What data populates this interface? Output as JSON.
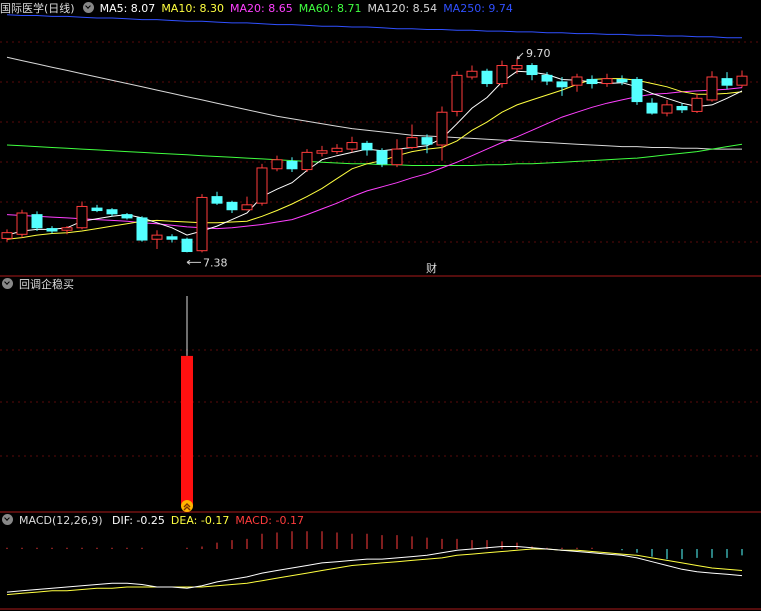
{
  "colors": {
    "background": "#000000",
    "separator": "#aa1a1a",
    "grid": "#5a0a0a",
    "up": "#ff3c3c",
    "down": "#54ffff",
    "ma5": "#ffffff",
    "ma10": "#ffff40",
    "ma20": "#ff40ff",
    "ma60": "#40ff40",
    "ma120": "#d8d8d8",
    "ma250": "#3050ff",
    "signal_bar": "#ff1010",
    "signal_icon": "#ffb400",
    "dif": "#ffffff",
    "dea": "#ffff40",
    "macd_up": "#ff3c3c",
    "macd_down": "#54ffff"
  },
  "price_panel": {
    "title": "国际医学(日线)",
    "legend": [
      {
        "key": "ma5",
        "text": "MA5: 8.07"
      },
      {
        "key": "ma10",
        "text": "MA10: 8.30"
      },
      {
        "key": "ma20",
        "text": "MA20: 8.65"
      },
      {
        "key": "ma60",
        "text": "MA60: 8.71"
      },
      {
        "key": "ma120",
        "text": "MA120: 8.54"
      },
      {
        "key": "ma250",
        "text": "MA250: 9.74"
      }
    ],
    "high_label": "9.70",
    "low_label": "7.38",
    "event_marker": "财"
  },
  "indicator_panel": {
    "title": "回调企稳买"
  },
  "macd_panel": {
    "title": "MACD(12,26,9)",
    "legend": [
      {
        "key": "dif",
        "text": "DIF: -0.25"
      },
      {
        "key": "dea",
        "text": "DEA: -0.17"
      },
      {
        "key": "macd_up",
        "text": "MACD: -0.17"
      }
    ]
  },
  "chart_data": {
    "type": "candlestick",
    "price_range": [
      7.1,
      10.2
    ],
    "candles": [
      [
        7.51,
        7.58,
        7.62,
        7.47
      ],
      [
        7.56,
        7.82,
        7.86,
        7.52
      ],
      [
        7.8,
        7.64,
        7.84,
        7.6
      ],
      [
        7.63,
        7.6,
        7.66,
        7.57
      ],
      [
        7.61,
        7.64,
        7.66,
        7.56
      ],
      [
        7.64,
        7.9,
        7.96,
        7.62
      ],
      [
        7.88,
        7.85,
        7.92,
        7.83
      ],
      [
        7.86,
        7.81,
        7.88,
        7.78
      ],
      [
        7.8,
        7.76,
        7.82,
        7.74
      ],
      [
        7.76,
        7.49,
        7.78,
        7.47
      ],
      [
        7.5,
        7.55,
        7.61,
        7.38
      ],
      [
        7.53,
        7.5,
        7.56,
        7.46
      ],
      [
        7.5,
        7.35,
        7.52,
        7.34
      ],
      [
        7.36,
        8.01,
        8.05,
        7.34
      ],
      [
        8.02,
        7.94,
        8.08,
        7.92
      ],
      [
        7.95,
        7.86,
        7.97,
        7.82
      ],
      [
        7.86,
        7.92,
        8.02,
        7.85
      ],
      [
        7.94,
        8.37,
        8.42,
        7.91
      ],
      [
        8.36,
        8.47,
        8.52,
        8.33
      ],
      [
        8.45,
        8.36,
        8.5,
        8.32
      ],
      [
        8.35,
        8.56,
        8.6,
        8.32
      ],
      [
        8.55,
        8.58,
        8.64,
        8.51
      ],
      [
        8.57,
        8.61,
        8.66,
        8.54
      ],
      [
        8.6,
        8.68,
        8.75,
        8.56
      ],
      [
        8.67,
        8.59,
        8.7,
        8.52
      ],
      [
        8.58,
        8.42,
        8.61,
        8.38
      ],
      [
        8.41,
        8.6,
        8.72,
        8.38
      ],
      [
        8.62,
        8.74,
        8.9,
        8.6
      ],
      [
        8.74,
        8.66,
        8.78,
        8.55
      ],
      [
        8.65,
        9.05,
        9.12,
        8.46
      ],
      [
        9.06,
        9.5,
        9.55,
        9.0
      ],
      [
        9.48,
        9.55,
        9.62,
        9.45
      ],
      [
        9.55,
        9.4,
        9.58,
        9.36
      ],
      [
        9.4,
        9.62,
        9.68,
        9.35
      ],
      [
        9.58,
        9.62,
        9.7,
        9.52
      ],
      [
        9.62,
        9.51,
        9.65,
        9.44
      ],
      [
        9.5,
        9.43,
        9.54,
        9.38
      ],
      [
        9.42,
        9.36,
        9.48,
        9.25
      ],
      [
        9.38,
        9.48,
        9.52,
        9.3
      ],
      [
        9.45,
        9.4,
        9.5,
        9.34
      ],
      [
        9.4,
        9.46,
        9.52,
        9.36
      ],
      [
        9.45,
        9.42,
        9.5,
        9.38
      ],
      [
        9.45,
        9.18,
        9.48,
        9.14
      ],
      [
        9.16,
        9.04,
        9.22,
        9.02
      ],
      [
        9.04,
        9.14,
        9.2,
        9.0
      ],
      [
        9.12,
        9.08,
        9.16,
        9.04
      ],
      [
        9.06,
        9.22,
        9.28,
        9.04
      ],
      [
        9.2,
        9.48,
        9.55,
        9.18
      ],
      [
        9.46,
        9.38,
        9.54,
        9.33
      ],
      [
        9.38,
        9.49,
        9.56,
        9.35
      ]
    ],
    "ma5": [
      7.55,
      7.6,
      7.62,
      7.62,
      7.64,
      7.72,
      7.75,
      7.78,
      7.8,
      7.76,
      7.7,
      7.64,
      7.55,
      7.6,
      7.66,
      7.74,
      7.82,
      8.02,
      8.11,
      8.19,
      8.34,
      8.47,
      8.52,
      8.56,
      8.6,
      8.58,
      8.6,
      8.62,
      8.64,
      8.73,
      8.91,
      9.1,
      9.23,
      9.42,
      9.55,
      9.54,
      9.51,
      9.45,
      9.44,
      9.42,
      9.4,
      9.41,
      9.36,
      9.28,
      9.22,
      9.16,
      9.12,
      9.14,
      9.22,
      9.31
    ],
    "ma10": [
      7.5,
      7.52,
      7.55,
      7.57,
      7.58,
      7.6,
      7.63,
      7.66,
      7.69,
      7.72,
      7.73,
      7.72,
      7.71,
      7.7,
      7.7,
      7.71,
      7.72,
      7.78,
      7.85,
      7.93,
      8.02,
      8.12,
      8.24,
      8.36,
      8.42,
      8.46,
      8.52,
      8.57,
      8.6,
      8.62,
      8.7,
      8.83,
      8.93,
      9.05,
      9.14,
      9.2,
      9.26,
      9.32,
      9.39,
      9.45,
      9.46,
      9.46,
      9.44,
      9.4,
      9.36,
      9.3,
      9.27,
      9.27,
      9.28,
      9.3
    ],
    "ma20": [
      7.8,
      7.79,
      7.78,
      7.77,
      7.76,
      7.75,
      7.74,
      7.73,
      7.72,
      7.7,
      7.69,
      7.67,
      7.65,
      7.64,
      7.63,
      7.64,
      7.66,
      7.68,
      7.71,
      7.74,
      7.8,
      7.87,
      7.94,
      8.02,
      8.09,
      8.14,
      8.19,
      8.25,
      8.3,
      8.37,
      8.44,
      8.52,
      8.6,
      8.68,
      8.75,
      8.83,
      8.91,
      8.99,
      9.05,
      9.11,
      9.16,
      9.2,
      9.24,
      9.27,
      9.28,
      9.3,
      9.31,
      9.32,
      9.33,
      9.35
    ],
    "ma60": [
      8.65,
      8.64,
      8.63,
      8.62,
      8.61,
      8.6,
      8.59,
      8.58,
      8.57,
      8.56,
      8.55,
      8.54,
      8.53,
      8.52,
      8.51,
      8.5,
      8.49,
      8.48,
      8.47,
      8.46,
      8.45,
      8.44,
      8.43,
      8.42,
      8.42,
      8.41,
      8.41,
      8.4,
      8.4,
      8.4,
      8.4,
      8.4,
      8.41,
      8.41,
      8.42,
      8.42,
      8.43,
      8.44,
      8.45,
      8.46,
      8.47,
      8.48,
      8.49,
      8.51,
      8.53,
      8.55,
      8.57,
      8.6,
      8.63,
      8.66
    ],
    "ma120": [
      9.72,
      9.68,
      9.64,
      9.6,
      9.56,
      9.52,
      9.48,
      9.44,
      9.4,
      9.36,
      9.32,
      9.28,
      9.24,
      9.2,
      9.16,
      9.12,
      9.08,
      9.04,
      9.0,
      8.97,
      8.94,
      8.91,
      8.88,
      8.85,
      8.83,
      8.81,
      8.79,
      8.77,
      8.76,
      8.75,
      8.74,
      8.73,
      8.72,
      8.71,
      8.7,
      8.69,
      8.68,
      8.67,
      8.66,
      8.65,
      8.64,
      8.63,
      8.63,
      8.62,
      8.62,
      8.61,
      8.61,
      8.6,
      8.6,
      8.6
    ],
    "ma250": [
      10.24,
      10.23,
      10.23,
      10.22,
      10.22,
      10.21,
      10.2,
      10.2,
      10.19,
      10.18,
      10.18,
      10.17,
      10.16,
      10.16,
      10.15,
      10.14,
      10.14,
      10.13,
      10.12,
      10.12,
      10.11,
      10.1,
      10.1,
      10.09,
      10.09,
      10.08,
      10.07,
      10.07,
      10.06,
      10.06,
      10.05,
      10.05,
      10.04,
      10.04,
      10.03,
      10.03,
      10.02,
      10.02,
      10.01,
      10.01,
      10.0,
      10.0,
      9.99,
      9.99,
      9.98,
      9.98,
      9.97,
      9.97,
      9.96,
      9.96
    ],
    "signal_bars": [
      {
        "index": 12,
        "value": 0.72,
        "wick_top": 1.0
      }
    ],
    "macd_range": [
      -0.45,
      0.15
    ],
    "dif": [
      -0.34,
      -0.33,
      -0.32,
      -0.31,
      -0.3,
      -0.29,
      -0.28,
      -0.27,
      -0.27,
      -0.28,
      -0.3,
      -0.3,
      -0.31,
      -0.29,
      -0.26,
      -0.24,
      -0.22,
      -0.19,
      -0.17,
      -0.15,
      -0.13,
      -0.11,
      -0.1,
      -0.09,
      -0.08,
      -0.08,
      -0.07,
      -0.06,
      -0.05,
      -0.03,
      -0.01,
      0.0,
      0.01,
      0.02,
      0.02,
      0.01,
      0.0,
      -0.01,
      -0.02,
      -0.03,
      -0.04,
      -0.05,
      -0.07,
      -0.1,
      -0.13,
      -0.16,
      -0.18,
      -0.19,
      -0.2,
      -0.21
    ],
    "dea": [
      -0.36,
      -0.35,
      -0.34,
      -0.33,
      -0.33,
      -0.32,
      -0.31,
      -0.31,
      -0.3,
      -0.3,
      -0.3,
      -0.3,
      -0.3,
      -0.3,
      -0.29,
      -0.28,
      -0.27,
      -0.25,
      -0.23,
      -0.21,
      -0.19,
      -0.17,
      -0.15,
      -0.13,
      -0.12,
      -0.11,
      -0.1,
      -0.09,
      -0.08,
      -0.07,
      -0.05,
      -0.04,
      -0.03,
      -0.02,
      -0.01,
      0.0,
      0.0,
      -0.01,
      -0.01,
      -0.02,
      -0.03,
      -0.04,
      -0.05,
      -0.07,
      -0.09,
      -0.11,
      -0.13,
      -0.15,
      -0.16,
      -0.17
    ],
    "macd": [
      0.01,
      0.01,
      0.01,
      0.01,
      0.01,
      0.01,
      0.01,
      0.01,
      0.01,
      0.01,
      0.0,
      0.0,
      0.01,
      0.02,
      0.05,
      0.07,
      0.08,
      0.12,
      0.13,
      0.14,
      0.14,
      0.14,
      0.13,
      0.12,
      0.12,
      0.11,
      0.11,
      0.1,
      0.09,
      0.08,
      0.08,
      0.07,
      0.07,
      0.06,
      0.05,
      0.02,
      0.01,
      0.01,
      0.01,
      0.01,
      0.0,
      -0.01,
      -0.03,
      -0.06,
      -0.08,
      -0.08,
      -0.07,
      -0.07,
      -0.07,
      -0.05
    ]
  }
}
